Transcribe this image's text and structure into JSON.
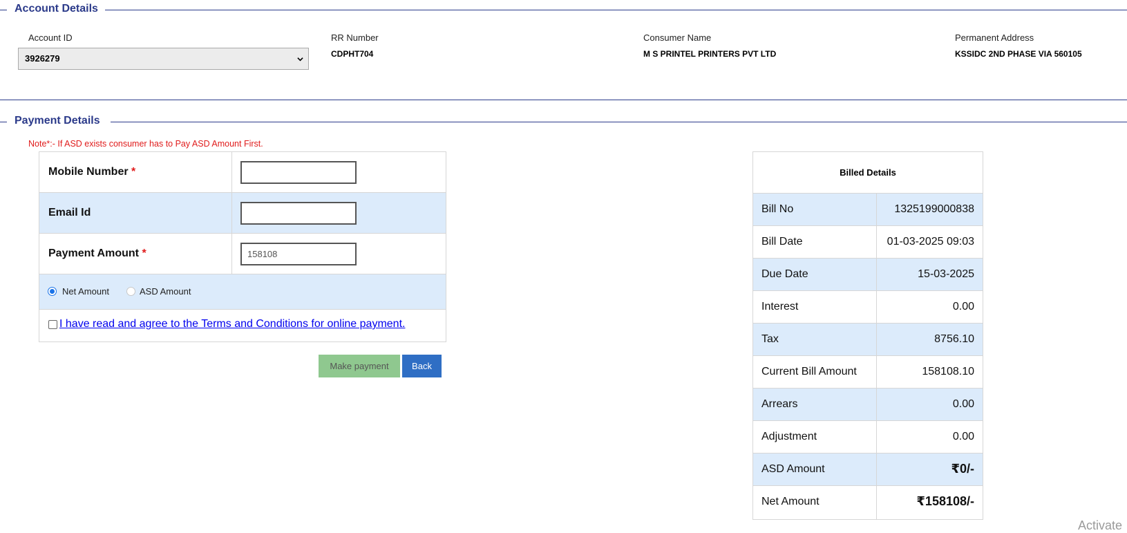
{
  "account_section": {
    "title": "Account Details",
    "account_id_label": "Account ID",
    "account_id_value": "3926279",
    "rr_label": "RR Number",
    "rr_value": "CDPHT704",
    "consumer_label": "Consumer Name",
    "consumer_value": "M S PRINTEL PRINTERS PVT LTD",
    "address_label": "Permanent Address",
    "address_value": "KSSIDC 2ND PHASE VIA 560105"
  },
  "payment_section": {
    "title": "Payment Details",
    "note": "Note*:- If ASD exists consumer has to Pay ASD Amount First.",
    "mobile_label": "Mobile Number",
    "email_label": "Email Id",
    "amount_label": "Payment Amount",
    "required_mark": "*",
    "mobile_value": "",
    "email_value": "",
    "amount_value": "158108",
    "radio_net_label": "Net Amount",
    "radio_asd_label": "ASD Amount",
    "selected_radio": "Net Amount",
    "terms_label": "I have read and agree to the Terms and Conditions for online payment.",
    "make_payment_label": "Make payment",
    "back_label": "Back"
  },
  "billed_details": {
    "title": "Billed Details",
    "rows": [
      {
        "label": "Bill No",
        "value": "1325199000838"
      },
      {
        "label": "Bill Date",
        "value": "01-03-2025 09:03"
      },
      {
        "label": "Due Date",
        "value": "15-03-2025"
      },
      {
        "label": "Interest",
        "value": "0.00"
      },
      {
        "label": "Tax",
        "value": "8756.10"
      },
      {
        "label": "Current Bill Amount",
        "value": "158108.10"
      },
      {
        "label": "Arrears",
        "value": "0.00"
      },
      {
        "label": "Adjustment",
        "value": "0.00"
      },
      {
        "label": "ASD Amount",
        "value": "₹0/-"
      },
      {
        "label": "Net Amount",
        "value": "₹158108/-"
      }
    ]
  },
  "watermark": "Activate",
  "colors": {
    "header_blue": "#2b3a8a",
    "row_blue": "#dcebfb",
    "required_red": "#e01b1b",
    "make_payment_green": "#8fc88f",
    "back_blue": "#2f6ec4",
    "link_blue": "#0000ee"
  }
}
